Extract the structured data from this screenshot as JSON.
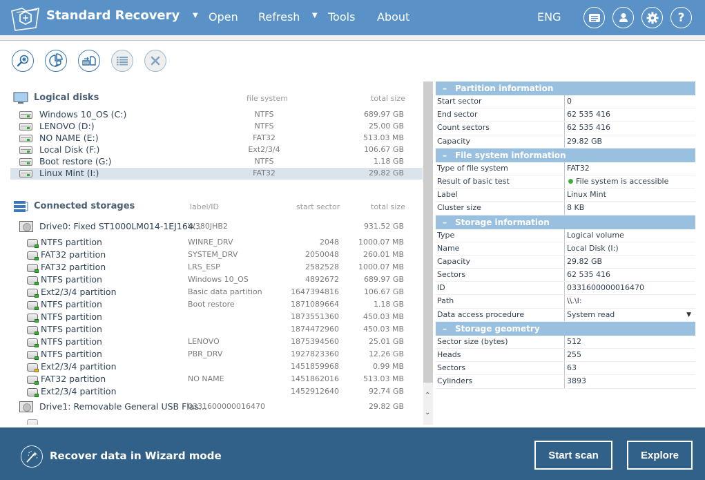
{
  "header": {
    "app_title": "Standard Recovery",
    "menu": [
      {
        "label": "Open",
        "has_caret": true
      },
      {
        "label": "Refresh",
        "has_caret": false
      },
      {
        "label": "Tools",
        "has_caret": true
      },
      {
        "label": "About",
        "has_caret": false
      }
    ],
    "language": "ENG",
    "icons": [
      "messages-icon",
      "user-icon",
      "gear-icon",
      "help-icon"
    ]
  },
  "toolbar": {
    "buttons": [
      {
        "name": "search-files-button",
        "icon": "magnifier-icon",
        "enabled": true
      },
      {
        "name": "analyze-button",
        "icon": "pie-search-icon",
        "enabled": true
      },
      {
        "name": "create-image-button",
        "icon": "file-transfer-icon",
        "enabled": true
      },
      {
        "name": "list-view-button",
        "icon": "list-icon",
        "enabled": false
      },
      {
        "name": "close-button",
        "icon": "close-icon",
        "enabled": false
      }
    ]
  },
  "logical_disks": {
    "title": "Logical disks",
    "columns": [
      "file system",
      "total size"
    ],
    "items": [
      {
        "name": "Windows 10_OS (C:)",
        "fs": "NTFS",
        "size": "689.97 GB"
      },
      {
        "name": "LENOVO (D:)",
        "fs": "NTFS",
        "size": "25.00 GB"
      },
      {
        "name": "NO NAME (E:)",
        "fs": "FAT32",
        "size": "513.03 MB"
      },
      {
        "name": "Local Disk (F:)",
        "fs": "Ext2/3/4",
        "size": "106.67 GB"
      },
      {
        "name": "Boot restore (G:)",
        "fs": "NTFS",
        "size": "1.18 GB"
      },
      {
        "name": "Linux Mint (I:)",
        "fs": "FAT32",
        "size": "29.82 GB",
        "selected": true
      }
    ]
  },
  "connected_storages": {
    "title": "Connected storages",
    "columns": [
      "label/ID",
      "start sector",
      "total size"
    ],
    "drive0": {
      "name": "Drive0: Fixed ST1000LM014-1EJ164...",
      "id": "W380JHB2",
      "size": "931.52 GB"
    },
    "partitions": [
      {
        "name": "NTFS partition",
        "label": "WINRE_DRV",
        "start": "2048",
        "size": "1000.07 MB",
        "status": "ok"
      },
      {
        "name": "FAT32 partition",
        "label": "SYSTEM_DRV",
        "start": "2050048",
        "size": "260.01 MB",
        "status": "ok"
      },
      {
        "name": "FAT32 partition",
        "label": "LRS_ESP",
        "start": "2582528",
        "size": "1000.07 MB",
        "status": "ok"
      },
      {
        "name": "NTFS partition",
        "label": "Windows 10_OS",
        "start": "4892672",
        "size": "689.97 GB",
        "status": "ok"
      },
      {
        "name": "Ext2/3/4 partition",
        "label": "Basic data partition",
        "start": "1647394816",
        "size": "106.67 GB",
        "status": "ok"
      },
      {
        "name": "NTFS partition",
        "label": "Boot restore",
        "start": "1871089664",
        "size": "1.18 GB",
        "status": "ok"
      },
      {
        "name": "NTFS partition",
        "label": "",
        "start": "1873551360",
        "size": "450.03 MB",
        "status": "ok"
      },
      {
        "name": "NTFS partition",
        "label": "",
        "start": "1874472960",
        "size": "450.03 MB",
        "status": "ok"
      },
      {
        "name": "NTFS partition",
        "label": "LENOVO",
        "start": "1875394560",
        "size": "25.01 GB",
        "status": "ok"
      },
      {
        "name": "NTFS partition",
        "label": "PBR_DRV",
        "start": "1927823360",
        "size": "12.26 GB",
        "status": "ok"
      },
      {
        "name": "Ext2/3/4 partition",
        "label": "",
        "start": "1451859968",
        "size": "0.99 MB",
        "status": "warn"
      },
      {
        "name": "FAT32 partition",
        "label": "NO NAME",
        "start": "1451862016",
        "size": "513.03 MB",
        "status": "ok"
      },
      {
        "name": "Ext2/3/4 partition",
        "label": "",
        "start": "1452912640",
        "size": "92.74 GB",
        "status": "ok"
      }
    ],
    "drive1": {
      "name": "Drive1: Removable General USB Flas...",
      "id": "0331600000016470",
      "size": "29.82 GB"
    }
  },
  "properties": {
    "partition_info": {
      "title": "Partition information",
      "rows": [
        {
          "k": "Start sector",
          "v": "0"
        },
        {
          "k": "End sector",
          "v": "62 535 416"
        },
        {
          "k": "Count sectors",
          "v": "62 535 416"
        },
        {
          "k": "Capacity",
          "v": "29.82 GB"
        }
      ]
    },
    "fs_info": {
      "title": "File system information",
      "rows": [
        {
          "k": "Type of file system",
          "v": "FAT32"
        },
        {
          "k": "Result of basic test",
          "v": "File system is accessible",
          "status_dot": true
        },
        {
          "k": "Label",
          "v": "Linux Mint"
        },
        {
          "k": "Cluster size",
          "v": "8 KB"
        }
      ]
    },
    "storage_info": {
      "title": "Storage information",
      "rows": [
        {
          "k": "Type",
          "v": "Logical volume"
        },
        {
          "k": "Name",
          "v": "Local Disk (I:)"
        },
        {
          "k": "Capacity",
          "v": "29.82 GB"
        },
        {
          "k": "Sectors",
          "v": "62 535 416"
        },
        {
          "k": "ID",
          "v": "0331600000016470"
        },
        {
          "k": "Path",
          "v": "\\\\.\\I:"
        },
        {
          "k": "Data access procedure",
          "v": "System read",
          "dropdown": true
        }
      ]
    },
    "geometry": {
      "title": "Storage geometry",
      "rows": [
        {
          "k": "Sector size (bytes)",
          "v": "512"
        },
        {
          "k": "Heads",
          "v": "255"
        },
        {
          "k": "Sectors",
          "v": "63"
        },
        {
          "k": "Cylinders",
          "v": "3893"
        }
      ]
    },
    "collapse_symbol": "–"
  },
  "footer": {
    "wizard_label": "Recover data in Wizard mode",
    "start_scan": "Start scan",
    "explore": "Explore"
  },
  "colors": {
    "header_bg": "#5a92c8",
    "footer_bg": "#316088",
    "section_head_bg": "#9ac0e0",
    "selected_row_bg": "#dbe3ec",
    "status_ok": "#35b12e",
    "status_warn": "#e8b92a"
  }
}
